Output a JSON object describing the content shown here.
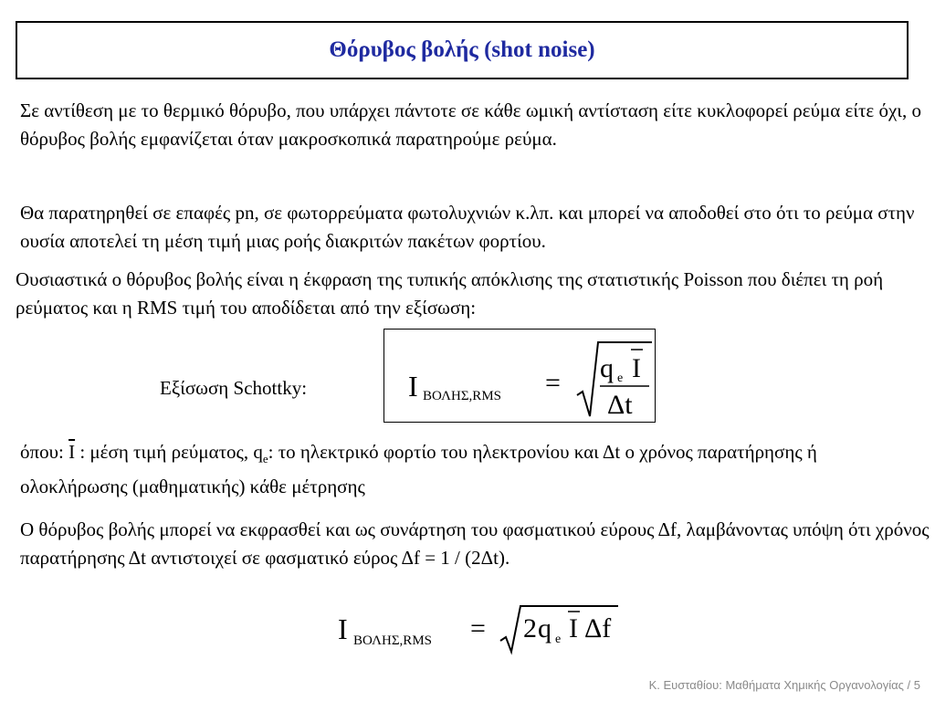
{
  "title": "Θόρυβος βολής (shot noise)",
  "paragraphs": {
    "p1": "Σε αντίθεση με το θερμικό θόρυβο, που υπάρχει πάντοτε σε κάθε ωμική αντίσταση είτε κυκλοφορεί ρεύμα είτε όχι, ο θόρυβος βολής εμφανίζεται όταν μακροσκοπικά παρατηρούμε ρεύμα.",
    "p2": "Θα παρατηρηθεί σε επαφές pn, σε φωτορρεύματα φωτολυχνιών κ.λπ. και μπορεί να αποδοθεί στο ότι το ρεύμα στην ουσία αποτελεί τη μέση τιμή μιας ροής διακριτών πακέτων φορτίου.",
    "p3": "Ουσιαστικά ο θόρυβος βολής είναι η έκφραση της τυπικής απόκλισης της στατιστικής Poisson που διέπει τη ροή ρεύματος και η RMS τιμή του αποδίδεται από την εξίσωση:",
    "p5": "Ο θόρυβος βολής μπορεί να εκφρασθεί και ως συνάρτηση του φασματικού εύρους Δf, λαμβάνοντας υπόψη ότι χρόνος παρατήρησης Δt αντιστοιχεί σε φασματικό εύρος Δf = 1 / (2Δt)."
  },
  "where": {
    "prefix": "όπου: ",
    "i_symbol": "I",
    "i_desc": " : μέση τιμή ρεύματος, q",
    "q_sub": "e",
    "rest": ": το ηλεκτρικό φορτίο του ηλεκτρονίου και Δt ο χρόνος παρατήρησης ή ολοκλήρωσης (μαθηματικής) κάθε μέτρησης"
  },
  "equation1": {
    "label": "Εξίσωση Schottky:",
    "lhs": "I",
    "lhs_sub": "ΒΟΛΗΣ,RMS",
    "equals": "=",
    "numerator_q": "q",
    "numerator_q_sub": "e",
    "numerator_i": "I",
    "denominator": "Δt"
  },
  "equation2": {
    "lhs": "I",
    "lhs_sub": "ΒΟΛΗΣ,RMS",
    "equals": "=",
    "two": "2",
    "q": "q",
    "q_sub": "e",
    "i": "I",
    "df": "Δf"
  },
  "footer": "Κ. Ευσταθίου: Μαθήματα Χημικής Οργανολογίας / 5",
  "colors": {
    "title": "#1f2aa0",
    "footer": "#8a8a8a"
  }
}
